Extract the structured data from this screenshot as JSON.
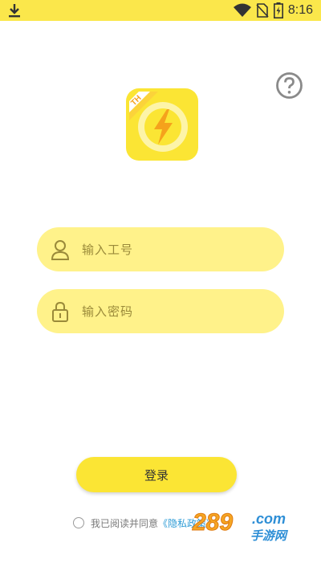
{
  "status_bar": {
    "time": "8:16",
    "icons": [
      "download-icon",
      "wifi-icon",
      "no-sim-icon",
      "battery-charging-icon"
    ]
  },
  "header": {
    "help_icon": "question-circle-icon"
  },
  "logo": {
    "badge_text": "TH",
    "icon": "lightning-bolt-icon"
  },
  "form": {
    "account_placeholder": "输入工号",
    "password_placeholder": "输入密码",
    "login_label": "登录"
  },
  "agreement": {
    "text": "我已阅读并同意",
    "link": "《隐私政策》"
  },
  "watermark": {
    "number": "289",
    "domain": ".com",
    "sub": "手游网"
  },
  "colors": {
    "status_bar": "#fbe74b",
    "field_bg": "#fff28a",
    "button_bg": "#fbe534",
    "icon_olive": "#9a8a3a",
    "link": "#2e9cd6"
  }
}
